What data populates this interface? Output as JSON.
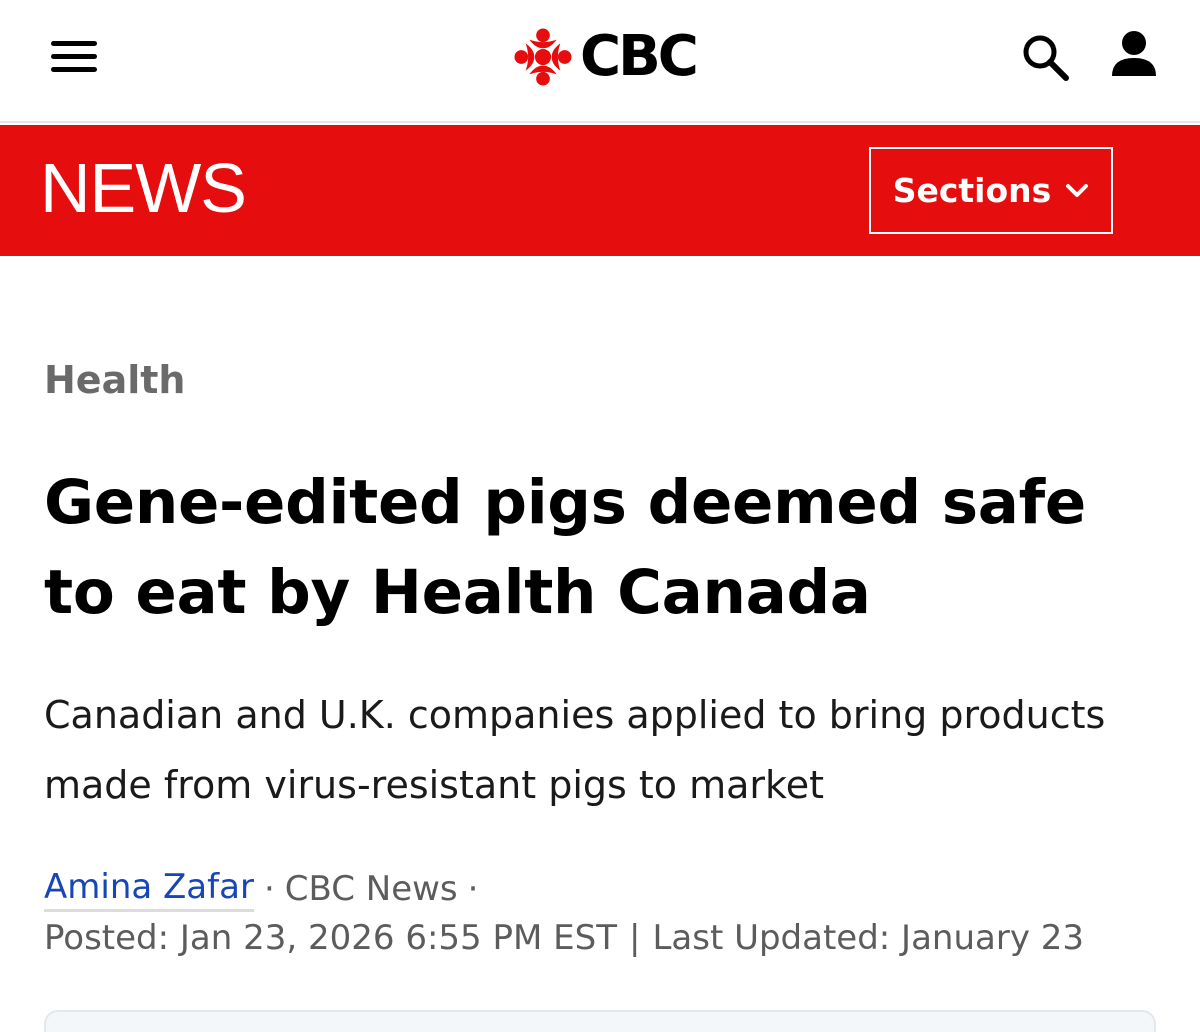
{
  "header": {
    "brand": "CBC"
  },
  "news_bar": {
    "title": "NEWS",
    "sections_label": "Sections"
  },
  "article": {
    "category": "Health",
    "headline": "Gene-edited pigs deemed safe to eat by Health Canada",
    "dek": "Canadian and U.K. companies applied to bring products made from virus-resistant pigs to market",
    "author": "Amina Zafar",
    "separator": "·",
    "outlet": "CBC News",
    "posted_label": "Posted: Jan 23, 2026 6:55 PM EST",
    "divider": "|",
    "updated_label": "Last Updated: January 23"
  },
  "colors": {
    "brand_red": "#e50d0d",
    "link_blue": "#1646b8",
    "meta_gray": "#5c5c5c"
  },
  "icons": {
    "menu": "hamburger-menu-icon",
    "logo": "cbc-gem-icon",
    "search": "search-icon",
    "account": "user-account-icon",
    "sections": "chevron-down-icon"
  }
}
